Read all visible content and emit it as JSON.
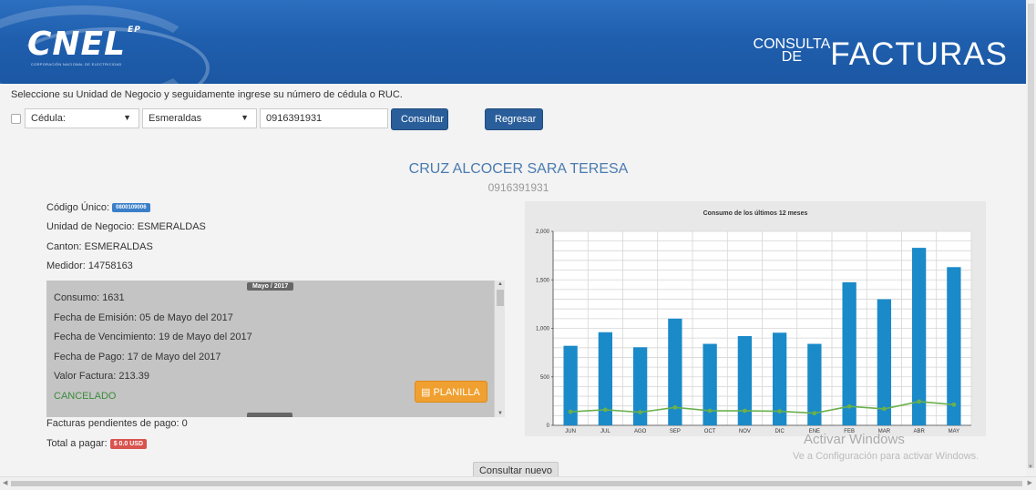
{
  "header": {
    "logo_text": "CNEL",
    "logo_suffix": "EP",
    "logo_subtitle": "CORPORACIÓN NACIONAL DE ELECTRICIDAD",
    "title_small_top": "CONSULTA",
    "title_small_bottom": "DE",
    "title_big": "FACTURAS"
  },
  "form": {
    "instructions": "Seleccione su Unidad de Negocio y seguidamente ingrese su número de cédula o RUC.",
    "id_type_selected": "Cédula:",
    "business_unit_selected": "Esmeraldas",
    "id_number_value": "0916391931",
    "consultar_label": "Consultar",
    "regresar_label": "Regresar"
  },
  "customer": {
    "name": "CRUZ ALCOCER SARA TERESA",
    "cedula": "0916391931",
    "codigo_label": "Código Único:",
    "codigo_value": "0800109006",
    "unidad_label": "Unidad de Negocio:",
    "unidad_value": "ESMERALDAS",
    "canton_label": "Canton:",
    "canton_value": "ESMERALDAS",
    "medidor_label": "Medidor:",
    "medidor_value": "14758163"
  },
  "invoice": {
    "month": "Mayo / 2017",
    "consumo": "Consumo: 1631",
    "emision": "Fecha de Emisión: 05 de Mayo del 2017",
    "vencimiento": "Fecha de Vencimiento: 19 de Mayo del 2017",
    "pago": "Fecha de Pago: 17 de Mayo del 2017",
    "valor": "Valor Factura: 213.39",
    "status": "CANCELADO",
    "planilla_label": "PLANILLA"
  },
  "summary": {
    "pendientes": "Facturas pendientes de pago: 0",
    "total_label": "Total a pagar:",
    "total_value": "$ 0.0 USD"
  },
  "chart_data": {
    "type": "bar",
    "title": "Consumo de los últimos 12 meses",
    "categories": [
      "JUN",
      "JUL",
      "AGO",
      "SEP",
      "OCT",
      "NOV",
      "DIC",
      "ENE",
      "FEB",
      "MAR",
      "ABR",
      "MAY"
    ],
    "series": [
      {
        "type": "bar",
        "values": [
          820,
          960,
          805,
          1100,
          840,
          920,
          955,
          840,
          1475,
          1300,
          1830,
          1631
        ],
        "color": "#1a8ac8"
      },
      {
        "type": "line",
        "values": [
          140,
          160,
          135,
          185,
          150,
          150,
          145,
          125,
          195,
          170,
          245,
          213
        ],
        "color": "#6ab04c"
      }
    ],
    "yticks": [
      "0",
      "500",
      "1,000",
      "1,500",
      "2,000"
    ],
    "ylim": [
      0,
      2000
    ],
    "grid": true
  },
  "watermark": {
    "line1": "Activar Windows",
    "line2": "Ve a Configuración para activar Windows."
  },
  "footer": {
    "consultar_nuevo": "Consultar nuevo"
  }
}
